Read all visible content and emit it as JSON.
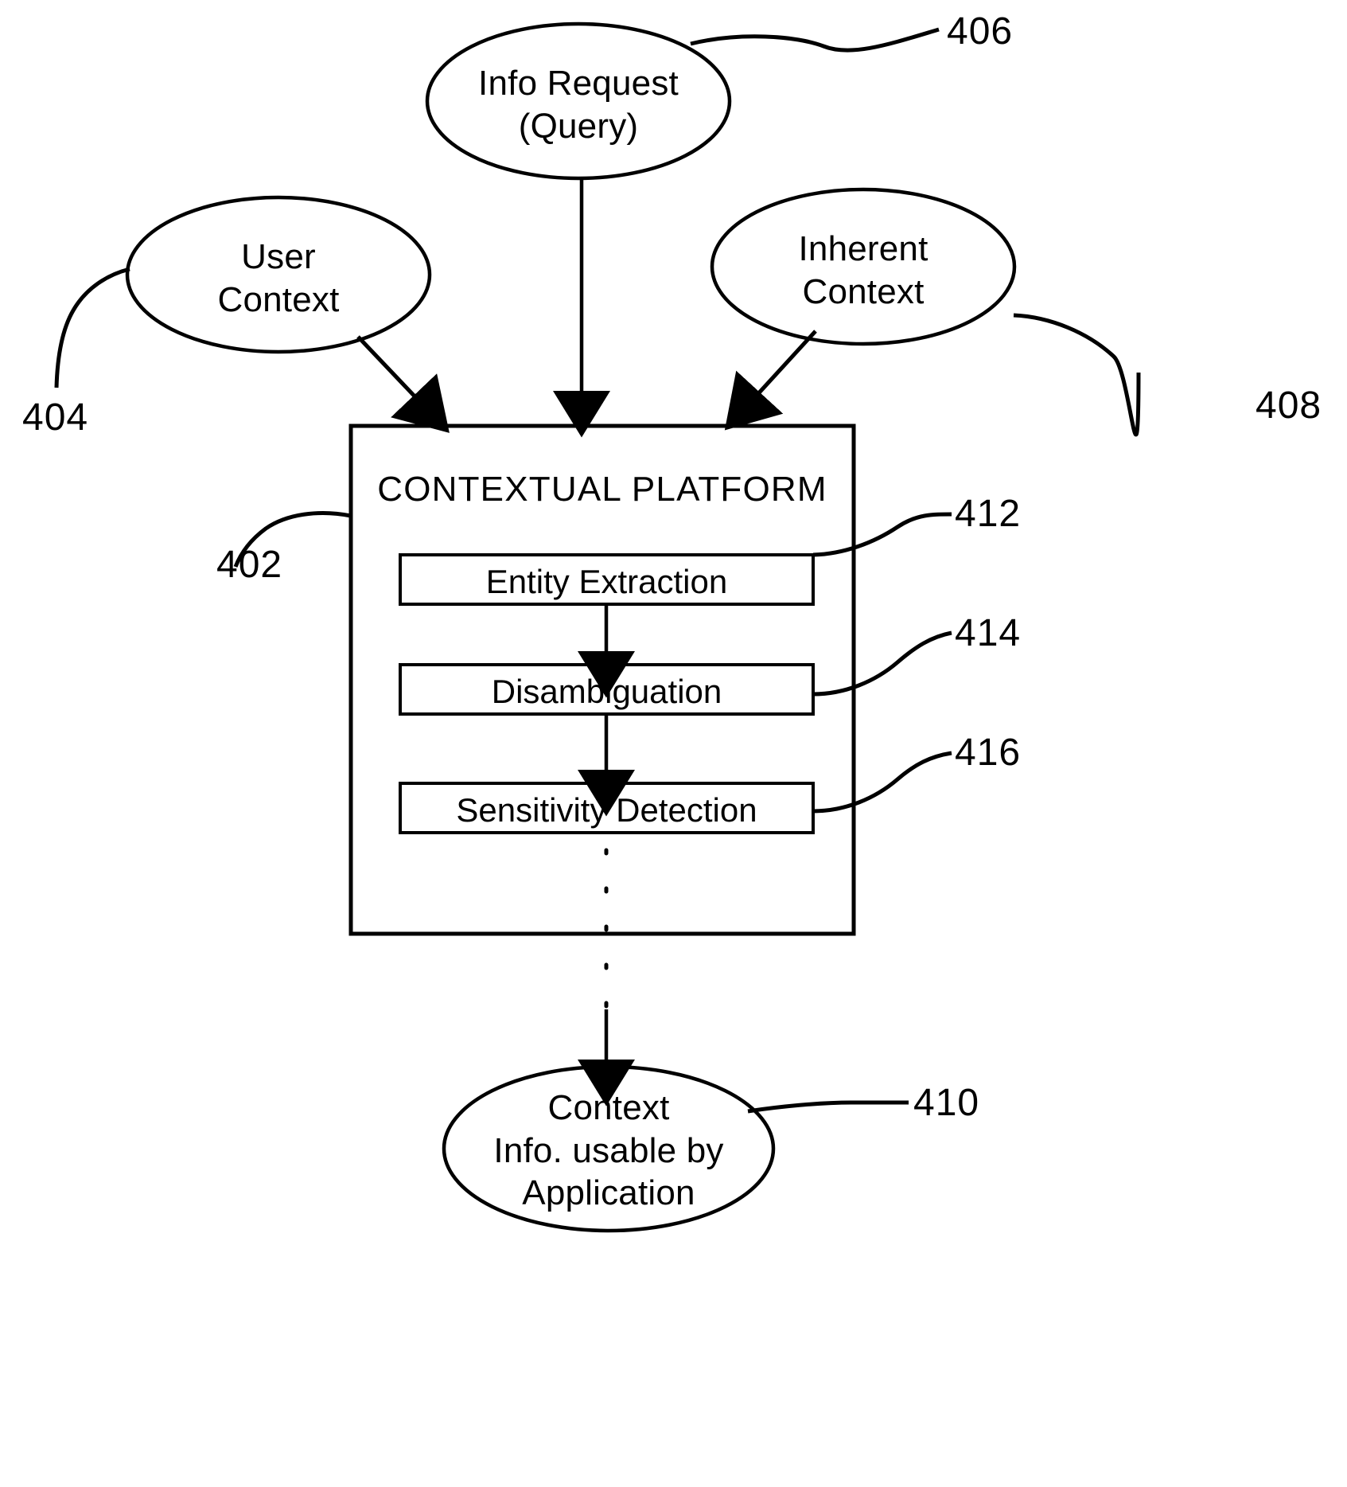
{
  "figure": {
    "type": "patent-flow-diagram",
    "background": "#ffffff",
    "stroke": "#000000"
  },
  "nodes": {
    "info_request": {
      "label": "Info Request\n(Query)",
      "ref": "406",
      "shape": "ellipse"
    },
    "user_context": {
      "label": "User\nContext",
      "ref": "404",
      "shape": "ellipse"
    },
    "inherent_context": {
      "label": "Inherent\nContext",
      "ref": "408",
      "shape": "ellipse"
    },
    "contextual_platform": {
      "label": "CONTEXTUAL PLATFORM",
      "ref": "402",
      "shape": "rectangle"
    },
    "output": {
      "label": "Context\nInfo. usable by\nApplication",
      "ref": "410",
      "shape": "ellipse"
    }
  },
  "stages": [
    {
      "label": "Entity Extraction",
      "ref": "412"
    },
    {
      "label": "Disambiguation",
      "ref": "414"
    },
    {
      "label": "Sensitivity Detection",
      "ref": "416"
    }
  ],
  "connectors": {
    "user_context_to_platform": "arrow",
    "info_request_to_platform": "arrow",
    "inherent_context_to_platform": "arrow",
    "entity_to_disambiguation": "arrow",
    "disambiguation_to_sensitivity": "arrow",
    "sensitivity_continuation": "vertical-dotted",
    "platform_to_output": "arrow"
  }
}
